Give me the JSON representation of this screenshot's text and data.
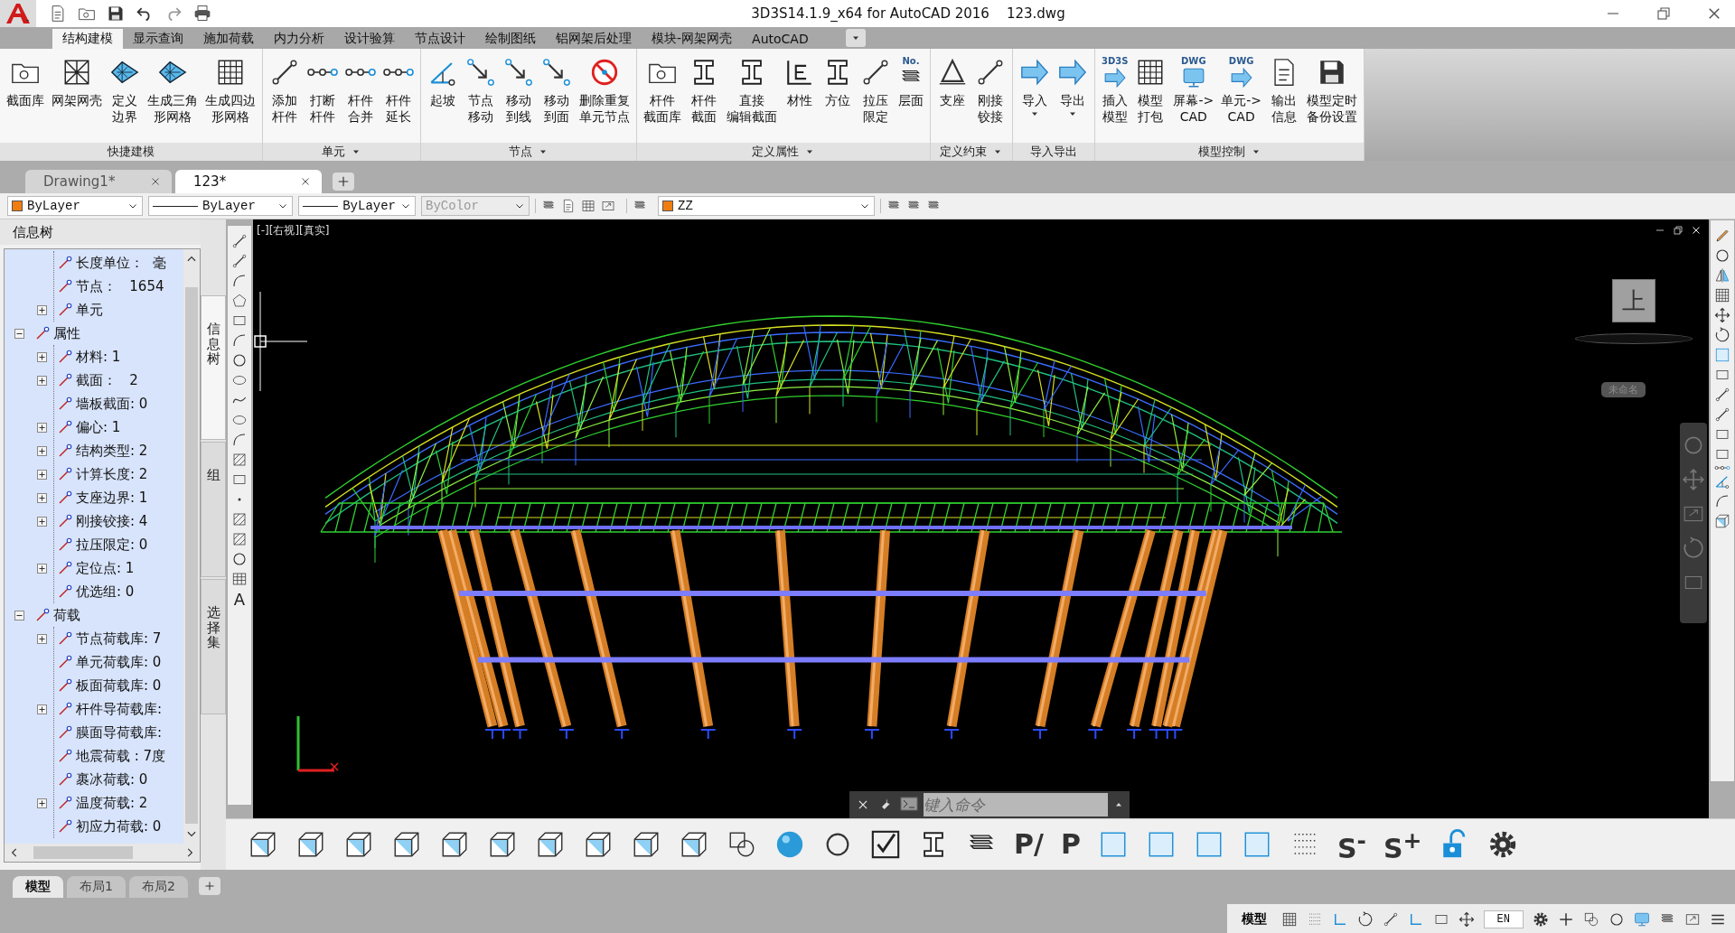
{
  "window": {
    "title": "3D3S14.1.9_x64 for AutoCAD 2016    123.dwg"
  },
  "quick_access": [
    {
      "kind": "document"
    },
    {
      "kind": "folder"
    },
    {
      "kind": "disk"
    },
    {
      "kind": "undo"
    },
    {
      "kind": "redo"
    },
    {
      "kind": "printer"
    }
  ],
  "ribbon_tabs": [
    {
      "label": "结构建模",
      "selected": true
    },
    {
      "label": "显示查询",
      "selected": false
    },
    {
      "label": "施加荷载",
      "selected": false
    },
    {
      "label": "内力分析",
      "selected": false
    },
    {
      "label": "设计验算",
      "selected": false
    },
    {
      "label": "节点设计",
      "selected": false
    },
    {
      "label": "绘制图纸",
      "selected": false
    },
    {
      "label": "铝网架后处理",
      "selected": false
    },
    {
      "label": "模块-网架网壳",
      "selected": false
    },
    {
      "label": "AutoCAD",
      "selected": false
    }
  ],
  "ribbon_panels": [
    {
      "label": "快捷建模",
      "has_menu": false,
      "buttons": [
        {
          "lines": [
            "截面库"
          ],
          "kind": "folder"
        },
        {
          "lines": [
            "网架网壳"
          ],
          "kind": "truss"
        },
        {
          "lines": [
            "定义",
            "边界"
          ],
          "kind": "diamond"
        },
        {
          "lines": [
            "生成三角",
            "形网格"
          ],
          "kind": "diamond"
        },
        {
          "lines": [
            "生成四边",
            "形网格"
          ],
          "kind": "grid"
        }
      ]
    },
    {
      "label": "单元",
      "has_menu": true,
      "buttons": [
        {
          "lines": [
            "添加",
            "杆件"
          ],
          "kind": "line"
        },
        {
          "lines": [
            "打断",
            "杆件"
          ],
          "kind": "nodeline"
        },
        {
          "lines": [
            "杆件",
            "合并"
          ],
          "kind": "nodeline"
        },
        {
          "lines": [
            "杆件",
            "延长"
          ],
          "kind": "nodeline"
        }
      ]
    },
    {
      "label": "节点",
      "has_menu": true,
      "buttons": [
        {
          "lines": [
            "起坡"
          ],
          "kind": "slope"
        },
        {
          "lines": [
            "节点",
            "移动"
          ],
          "kind": "movenode"
        },
        {
          "lines": [
            "移动",
            "到线"
          ],
          "kind": "movenode"
        },
        {
          "lines": [
            "移动",
            "到面"
          ],
          "kind": "movenode"
        },
        {
          "lines": [
            "删除重复",
            "单元节点"
          ],
          "kind": "prohibit"
        }
      ]
    },
    {
      "label": "定义属性",
      "has_menu": true,
      "buttons": [
        {
          "lines": [
            "杆件",
            "截面库"
          ],
          "kind": "folder"
        },
        {
          "lines": [
            "杆件",
            "截面"
          ],
          "kind": "beam"
        },
        {
          "lines": [
            "直接",
            "编辑截面"
          ],
          "kind": "beam"
        },
        {
          "lines": [
            "材性"
          ],
          "kind": "axis"
        },
        {
          "lines": [
            "方位"
          ],
          "kind": "beam"
        },
        {
          "lines": [
            "拉压",
            "限定"
          ],
          "kind": "line"
        },
        {
          "lines": [
            "层面"
          ],
          "kind": "layers",
          "icon_text": "No."
        }
      ]
    },
    {
      "label": "定义约束",
      "has_menu": true,
      "buttons": [
        {
          "lines": [
            "支座"
          ],
          "kind": "triangle"
        },
        {
          "lines": [
            "刚接",
            "铰接"
          ],
          "kind": "line"
        }
      ]
    },
    {
      "label": "导入导出",
      "has_menu": false,
      "buttons": [
        {
          "lines": [
            "导入"
          ],
          "kind": "arrow",
          "has_menu": true
        },
        {
          "lines": [
            "导出"
          ],
          "kind": "arrow",
          "has_menu": true
        }
      ]
    },
    {
      "label": "模型控制",
      "has_menu": true,
      "buttons": [
        {
          "lines": [
            "插入",
            "模型"
          ],
          "kind": "arrow",
          "icon_text": "3D3S"
        },
        {
          "lines": [
            "模型",
            "打包"
          ],
          "kind": "grid"
        },
        {
          "lines": [
            "屏幕->",
            "CAD"
          ],
          "kind": "monitor",
          "icon_text": "DWG"
        },
        {
          "lines": [
            "单元->",
            "CAD"
          ],
          "kind": "arrow",
          "icon_text": "DWG"
        },
        {
          "lines": [
            "输出",
            "信息"
          ],
          "kind": "document"
        },
        {
          "lines": [
            "模型定时",
            "备份设置"
          ],
          "kind": "disk"
        }
      ]
    }
  ],
  "file_tabs": [
    {
      "label": "Drawing1*",
      "selected": false
    },
    {
      "label": "123*",
      "selected": true
    }
  ],
  "properties_bar": {
    "color": {
      "value": "ByLayer",
      "color": "#f07d10"
    },
    "linetype": "ByLayer",
    "lineweight": "ByLayer",
    "plot_style": {
      "value": "ByColor",
      "disabled": true
    },
    "layer": {
      "value": "ZZ",
      "color": "#f07d10"
    }
  },
  "info_tree": {
    "title": "信息树",
    "scrolled_parent_children": [
      {
        "label": "长度单位：  毫",
        "has_children": false,
        "expanded": false
      },
      {
        "label": "节点：   1654",
        "has_children": false,
        "expanded": false
      },
      {
        "label": "单元",
        "has_children": true,
        "expanded": false
      }
    ],
    "items": [
      {
        "label": "属性",
        "has_children": true,
        "expanded": true,
        "children": [
          {
            "label": "材料: 1",
            "has_children": true,
            "expanded": false
          },
          {
            "label": "截面：   2",
            "has_children": true,
            "expanded": false
          },
          {
            "label": "墙板截面: 0",
            "has_children": false,
            "expanded": false
          },
          {
            "label": "偏心: 1",
            "has_children": true,
            "expanded": false
          },
          {
            "label": "结构类型: 2",
            "has_children": true,
            "expanded": false
          },
          {
            "label": "计算长度: 2",
            "has_children": true,
            "expanded": false
          },
          {
            "label": "支座边界: 1",
            "has_children": true,
            "expanded": false
          },
          {
            "label": "刚接铰接: 4",
            "has_children": true,
            "expanded": false
          },
          {
            "label": "拉压限定: 0",
            "has_children": false,
            "expanded": false
          },
          {
            "label": "定位点: 1",
            "has_children": true,
            "expanded": false
          },
          {
            "label": "优选组: 0",
            "has_children": false,
            "expanded": false
          }
        ]
      },
      {
        "label": "荷载",
        "has_children": true,
        "expanded": true,
        "children": [
          {
            "label": "节点荷载库: 7",
            "has_children": true,
            "expanded": false
          },
          {
            "label": "单元荷载库: 0",
            "has_children": false,
            "expanded": false
          },
          {
            "label": "板面荷载库: 0",
            "has_children": false,
            "expanded": false
          },
          {
            "label": "杆件导荷载库:",
            "has_children": true,
            "expanded": false
          },
          {
            "label": "膜面导荷载库:",
            "has_children": false,
            "expanded": false
          },
          {
            "label": "地震荷载 : 7度",
            "has_children": false,
            "expanded": false
          },
          {
            "label": "裹冰荷载: 0",
            "has_children": false,
            "expanded": false
          },
          {
            "label": "温度荷载: 2",
            "has_children": true,
            "expanded": false
          },
          {
            "label": "初应力荷载: 0",
            "has_children": false,
            "expanded": false
          }
        ]
      }
    ]
  },
  "side_tabs": [
    {
      "label": "信息树",
      "selected": true
    },
    {
      "label": "组",
      "selected": false
    },
    {
      "label": "选择集",
      "selected": false
    }
  ],
  "draw_tools": [
    {
      "kind": "line"
    },
    {
      "kind": "line"
    },
    {
      "kind": "arc"
    },
    {
      "kind": "polygon"
    },
    {
      "kind": "rect"
    },
    {
      "kind": "arc"
    },
    {
      "kind": "circle"
    },
    {
      "kind": "ellipse"
    },
    {
      "kind": "spline"
    },
    {
      "kind": "ellipse"
    },
    {
      "kind": "arc"
    },
    {
      "kind": "hatch"
    },
    {
      "kind": "rect"
    },
    {
      "kind": "point"
    },
    {
      "kind": "hatch"
    },
    {
      "kind": "hatch"
    },
    {
      "kind": "circle"
    },
    {
      "kind": "table"
    },
    {
      "kind": "text",
      "text": "A"
    }
  ],
  "viewport": {
    "view_label": "[-][右视][真实]",
    "viewcube_face": "上",
    "visual_style": "未命名",
    "command_placeholder": "键入命令"
  },
  "modify_tools": [
    {
      "kind": "pencil"
    },
    {
      "kind": "circle"
    },
    {
      "kind": "mirror"
    },
    {
      "kind": "grid"
    },
    {
      "kind": "move"
    },
    {
      "kind": "rotate"
    },
    {
      "kind": "bluerect"
    },
    {
      "kind": "rect"
    },
    {
      "kind": "line"
    },
    {
      "kind": "line"
    },
    {
      "kind": "rect"
    },
    {
      "kind": "rect"
    },
    {
      "kind": "nodeline"
    },
    {
      "kind": "slope"
    },
    {
      "kind": "arc"
    },
    {
      "kind": "cube"
    }
  ],
  "bottom_tools": [
    {
      "kind": "cube"
    },
    {
      "kind": "cube"
    },
    {
      "kind": "cube"
    },
    {
      "kind": "cube"
    },
    {
      "kind": "cube"
    },
    {
      "kind": "cube"
    },
    {
      "kind": "cube"
    },
    {
      "kind": "cube"
    },
    {
      "kind": "cube"
    },
    {
      "kind": "cube"
    },
    {
      "kind": "boxcircle"
    },
    {
      "kind": "sphere"
    },
    {
      "kind": "circle"
    },
    {
      "kind": "check"
    },
    {
      "kind": "beam"
    },
    {
      "kind": "layers"
    },
    {
      "kind": "text",
      "text": "P/"
    },
    {
      "kind": "text",
      "text": "P"
    },
    {
      "kind": "bluerect"
    },
    {
      "kind": "bluerect"
    },
    {
      "kind": "bluerect"
    },
    {
      "kind": "bluerect"
    },
    {
      "kind": "dots"
    },
    {
      "kind": "text",
      "text": "S$^{-}$"
    },
    {
      "kind": "text",
      "text": "S$^{+}$"
    },
    {
      "kind": "lock"
    },
    {
      "kind": "gear"
    }
  ],
  "layout_tabs": [
    {
      "label": "模型",
      "selected": true
    },
    {
      "label": "布局1",
      "selected": false
    },
    {
      "label": "布局2",
      "selected": false
    }
  ],
  "status_bar": {
    "model_label": "模型",
    "language": "EN",
    "tools": [
      {
        "kind": "grid"
      },
      {
        "kind": "dots"
      },
      {
        "kind": "angle"
      },
      {
        "kind": "rotate"
      },
      {
        "kind": "line"
      },
      {
        "kind": "angle"
      },
      {
        "kind": "rect"
      },
      {
        "kind": "move"
      },
      {
        "kind": "gear"
      },
      {
        "kind": "plus"
      },
      {
        "kind": "boxcircle"
      },
      {
        "kind": "circle"
      },
      {
        "kind": "monitor"
      },
      {
        "kind": "layers"
      },
      {
        "kind": "fullscreen"
      },
      {
        "kind": "menu"
      }
    ]
  }
}
